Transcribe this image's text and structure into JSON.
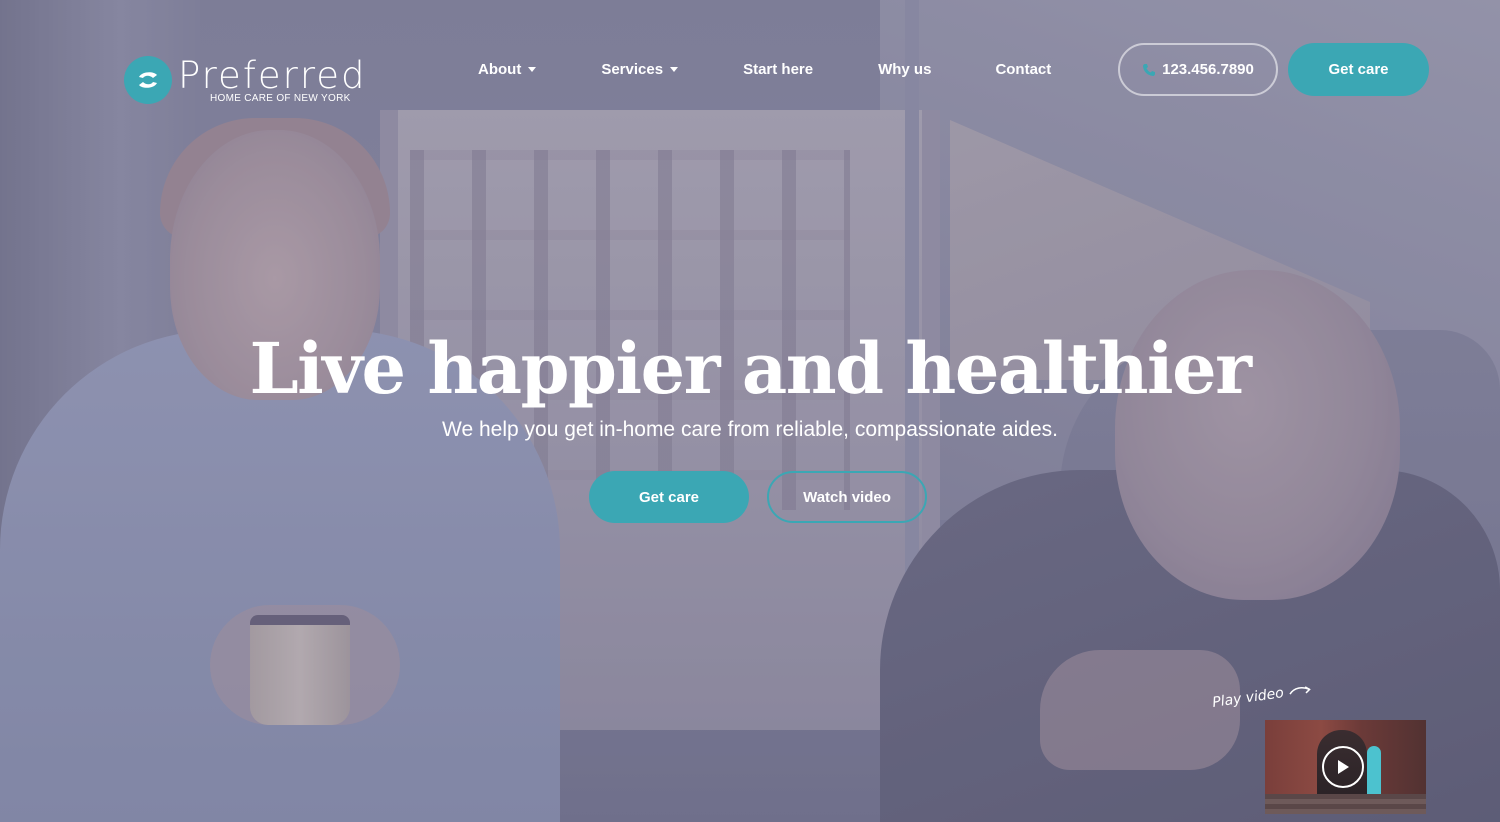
{
  "brand": {
    "name": "Preferred",
    "tagline": "HOME CARE OF NEW YORK",
    "accent_color": "#3ba7b4"
  },
  "nav": {
    "items": [
      {
        "label": "About",
        "has_dropdown": true
      },
      {
        "label": "Services",
        "has_dropdown": true
      },
      {
        "label": "Start here",
        "has_dropdown": false
      },
      {
        "label": "Why us",
        "has_dropdown": false
      },
      {
        "label": "Contact",
        "has_dropdown": false
      }
    ]
  },
  "header": {
    "phone": "123.456.7890",
    "phone_icon": "phone-icon",
    "cta_label": "Get care"
  },
  "hero": {
    "title": "Live happier and healthier",
    "subtitle": "We help you get in-home care from reliable, compassionate aides.",
    "primary_cta": "Get care",
    "secondary_cta": "Watch video"
  },
  "video": {
    "label": "Play video",
    "play_icon": "play-icon"
  }
}
